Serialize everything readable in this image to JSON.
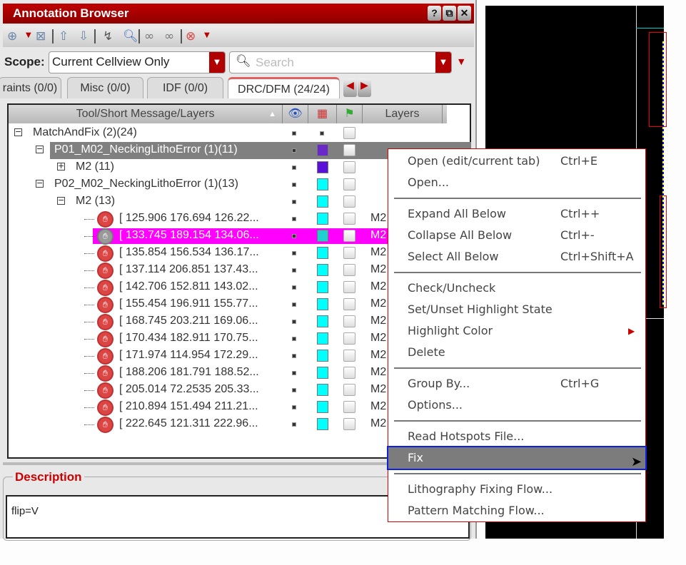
{
  "window": {
    "title": "Annotation Browser",
    "help": "?",
    "restore": "⧉",
    "close": "✕"
  },
  "toolbar": {
    "icons": [
      "zoom-fit-icon",
      "zoom-select-icon",
      "arrow-up-icon",
      "arrow-down-icon",
      "cursor-icon",
      "magnifier-icon",
      "binoculars-icon",
      "binoculars-clear-icon",
      "delete-icon"
    ]
  },
  "scope": {
    "label": "Scope:",
    "value": "Current Cellview Only"
  },
  "search": {
    "placeholder": "Search"
  },
  "tabs": [
    {
      "label": "raints (0/0)"
    },
    {
      "label": "Misc (0/0)"
    },
    {
      "label": "IDF (0/0)"
    },
    {
      "label": "DRC/DFM (24/24)",
      "active": true
    }
  ],
  "tree": {
    "headers": {
      "name": "Tool/Short Message/Layers",
      "layers": "Layers"
    },
    "rows": [
      {
        "text": "MatchAndFix (2)(24)",
        "level": 0,
        "toggle": "−",
        "color": null
      },
      {
        "text": "P01_M02_NeckingLithoError (1)(11)",
        "level": 1,
        "toggle": "−",
        "color": "#6a28c8",
        "selected": "gray"
      },
      {
        "text": "M2 (11)",
        "level": 2,
        "toggle": "+",
        "color": "#5a10d8"
      },
      {
        "text": "P02_M02_NeckingLithoError (1)(13)",
        "level": 1,
        "toggle": "−",
        "color": "#00ffff"
      },
      {
        "text": "M2 (13)",
        "level": 2,
        "toggle": "−",
        "color": "#00ffff"
      },
      {
        "text": "[ 125.906 176.694 126.22...",
        "leaf": true,
        "layer": "M2",
        "color": "#00ffff"
      },
      {
        "text": "[ 133.745 189.154 134.06...",
        "leaf": true,
        "layer": "M2",
        "color": "#20d0d0",
        "selected": "magenta"
      },
      {
        "text": "[ 135.854 156.534 136.17...",
        "leaf": true,
        "layer": "M2",
        "color": "#00ffff"
      },
      {
        "text": "[ 137.114 206.851 137.43...",
        "leaf": true,
        "layer": "M2",
        "color": "#00ffff"
      },
      {
        "text": "[ 142.706 152.811 143.02...",
        "leaf": true,
        "layer": "M2",
        "color": "#00ffff"
      },
      {
        "text": "[ 155.454 196.911 155.77...",
        "leaf": true,
        "layer": "M2",
        "color": "#00ffff"
      },
      {
        "text": "[ 168.745 203.211 169.06...",
        "leaf": true,
        "layer": "M2",
        "color": "#00ffff"
      },
      {
        "text": "[ 170.434 182.911 170.75...",
        "leaf": true,
        "layer": "M2",
        "color": "#00ffff"
      },
      {
        "text": "[ 171.974 114.954 172.29...",
        "leaf": true,
        "layer": "M2",
        "color": "#00ffff"
      },
      {
        "text": "[ 188.206 181.791 188.52...",
        "leaf": true,
        "layer": "M2",
        "color": "#00ffff"
      },
      {
        "text": "[ 205.014 72.2535 205.33...",
        "leaf": true,
        "layer": "M2",
        "color": "#00ffff"
      },
      {
        "text": "[ 210.894 151.494 211.21...",
        "leaf": true,
        "layer": "M2",
        "color": "#00ffff"
      },
      {
        "text": "[ 222.645 121.311 222.96...",
        "leaf": true,
        "layer": "M2",
        "color": "#00ffff"
      }
    ]
  },
  "description": {
    "label": "Description",
    "text": "flip=V"
  },
  "context_menu": {
    "items": [
      {
        "label": "Open (edit/current tab)",
        "shortcut": "Ctrl+E"
      },
      {
        "label": "Open..."
      },
      {
        "sep": true
      },
      {
        "label": "Expand All Below",
        "shortcut": "Ctrl++"
      },
      {
        "label": "Collapse All Below",
        "shortcut": "Ctrl+-"
      },
      {
        "label": "Select All Below",
        "shortcut": "Ctrl+Shift+A"
      },
      {
        "sep": true
      },
      {
        "label": "Check/Uncheck"
      },
      {
        "label": "Set/Unset Highlight State"
      },
      {
        "label": "Highlight Color",
        "submenu": true
      },
      {
        "label": "Delete"
      },
      {
        "sep": true
      },
      {
        "label": "Group By...",
        "shortcut": "Ctrl+G"
      },
      {
        "label": "Options..."
      },
      {
        "sep": true
      },
      {
        "label": "Read Hotspots File..."
      },
      {
        "label": "Fix",
        "highlighted": true
      },
      {
        "sep": true
      },
      {
        "label": "Lithography Fixing Flow..."
      },
      {
        "label": "Pattern Matching Flow..."
      }
    ]
  },
  "colors": {
    "accent": "#b00000",
    "selection": "#ff00ff",
    "canvas": "#000000"
  }
}
